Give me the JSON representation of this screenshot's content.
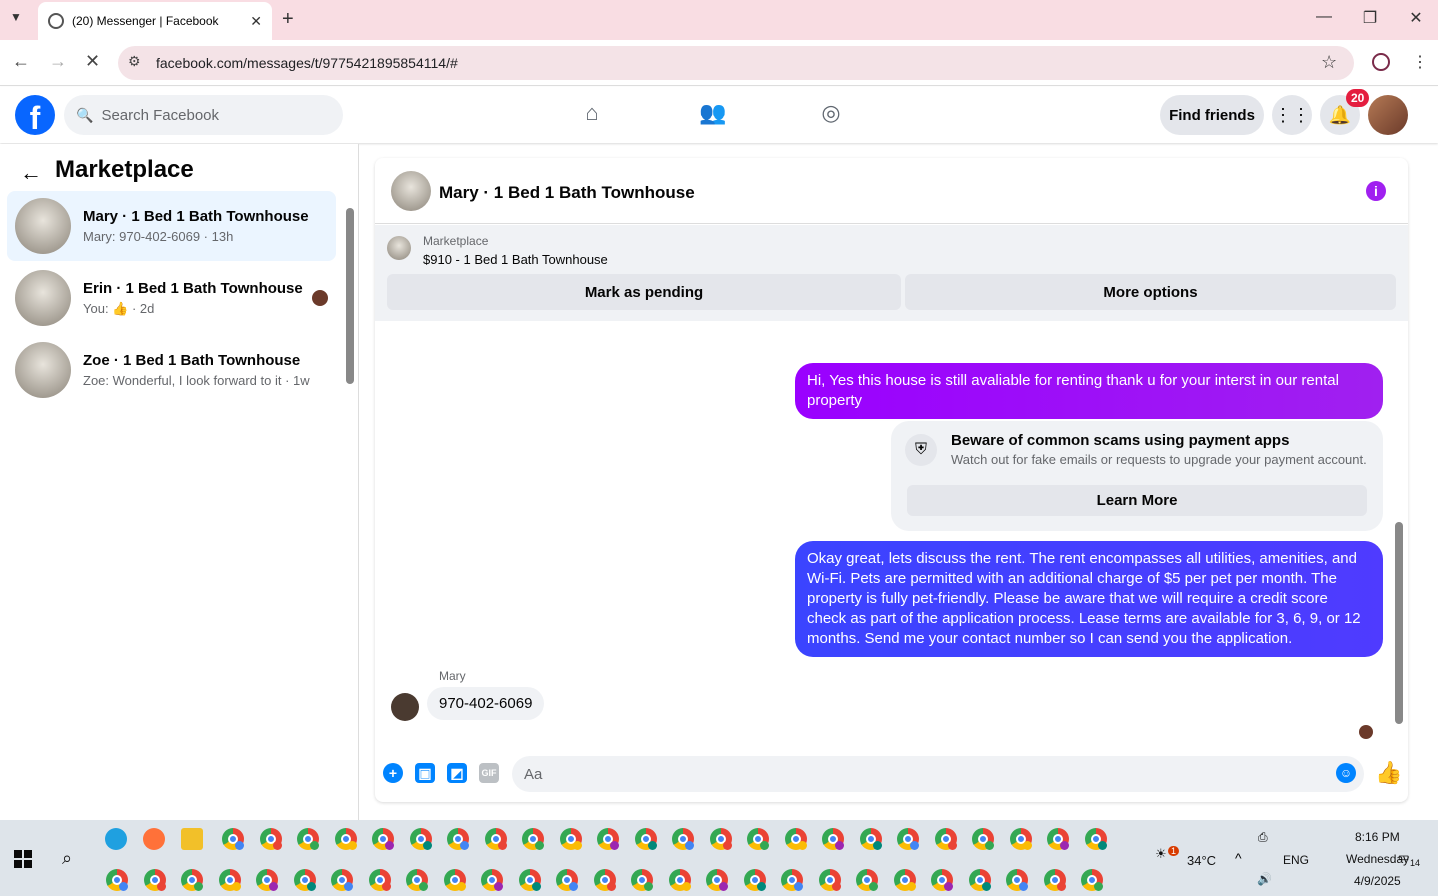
{
  "browser": {
    "tab_title": "(20) Messenger | Facebook",
    "url": "facebook.com/messages/t/9775421895854114/#"
  },
  "fb": {
    "search_placeholder": "Search Facebook",
    "find_friends": "Find friends",
    "notif_count": "20"
  },
  "sidebar": {
    "title": "Marketplace",
    "conversations": [
      {
        "name": "Mary · 1 Bed 1 Bath Townhouse",
        "preview": "Mary: 970-402-6069 · 13h"
      },
      {
        "name": "Erin · 1 Bed 1 Bath Townhouse",
        "preview": "You: 👍 · 2d"
      },
      {
        "name": "Zoe · 1 Bed 1 Bath Townhouse",
        "preview": "Zoe: Wonderful, I look forward to it · 1w"
      }
    ]
  },
  "chat": {
    "title": "Mary · 1 Bed 1 Bath Townhouse",
    "marketplace_label": "Marketplace",
    "listing": "$910 - 1 Bed 1 Bath Townhouse",
    "mark_pending": "Mark as pending",
    "more_options": "More options",
    "msg1": "Hi, Yes this house is still avaliable for renting thank u for your interst in our rental property",
    "scam_title": "Beware of common scams using payment apps",
    "scam_sub": "Watch out for fake emails or requests to upgrade your payment account.",
    "learn_more": "Learn More",
    "msg2": "Okay great, lets discuss the rent. The rent encompasses all utilities, amenities, and Wi-Fi. Pets are permitted with an additional charge of $5 per pet per month. The property is fully pet-friendly. Please be aware that we will require a credit score check as part of the application process. Lease terms are available for 3, 6, 9, or 12 months. Send me your contact number so I can send you the application.",
    "sender": "Mary",
    "msg3": "970-402-6069",
    "composer_placeholder": "Aa"
  },
  "taskbar": {
    "weather_badge": "1",
    "temperature": "34°C",
    "lang": "ENG",
    "time": "8:16 PM",
    "day": "Wednesday",
    "date": "4/9/2025",
    "notif_count": "14"
  },
  "colors": {
    "fb_blue": "#0866ff",
    "bubble_purple": "#a020f0",
    "bubble_blue": "#4f3bff",
    "tab_bar": "#f9dde3"
  }
}
